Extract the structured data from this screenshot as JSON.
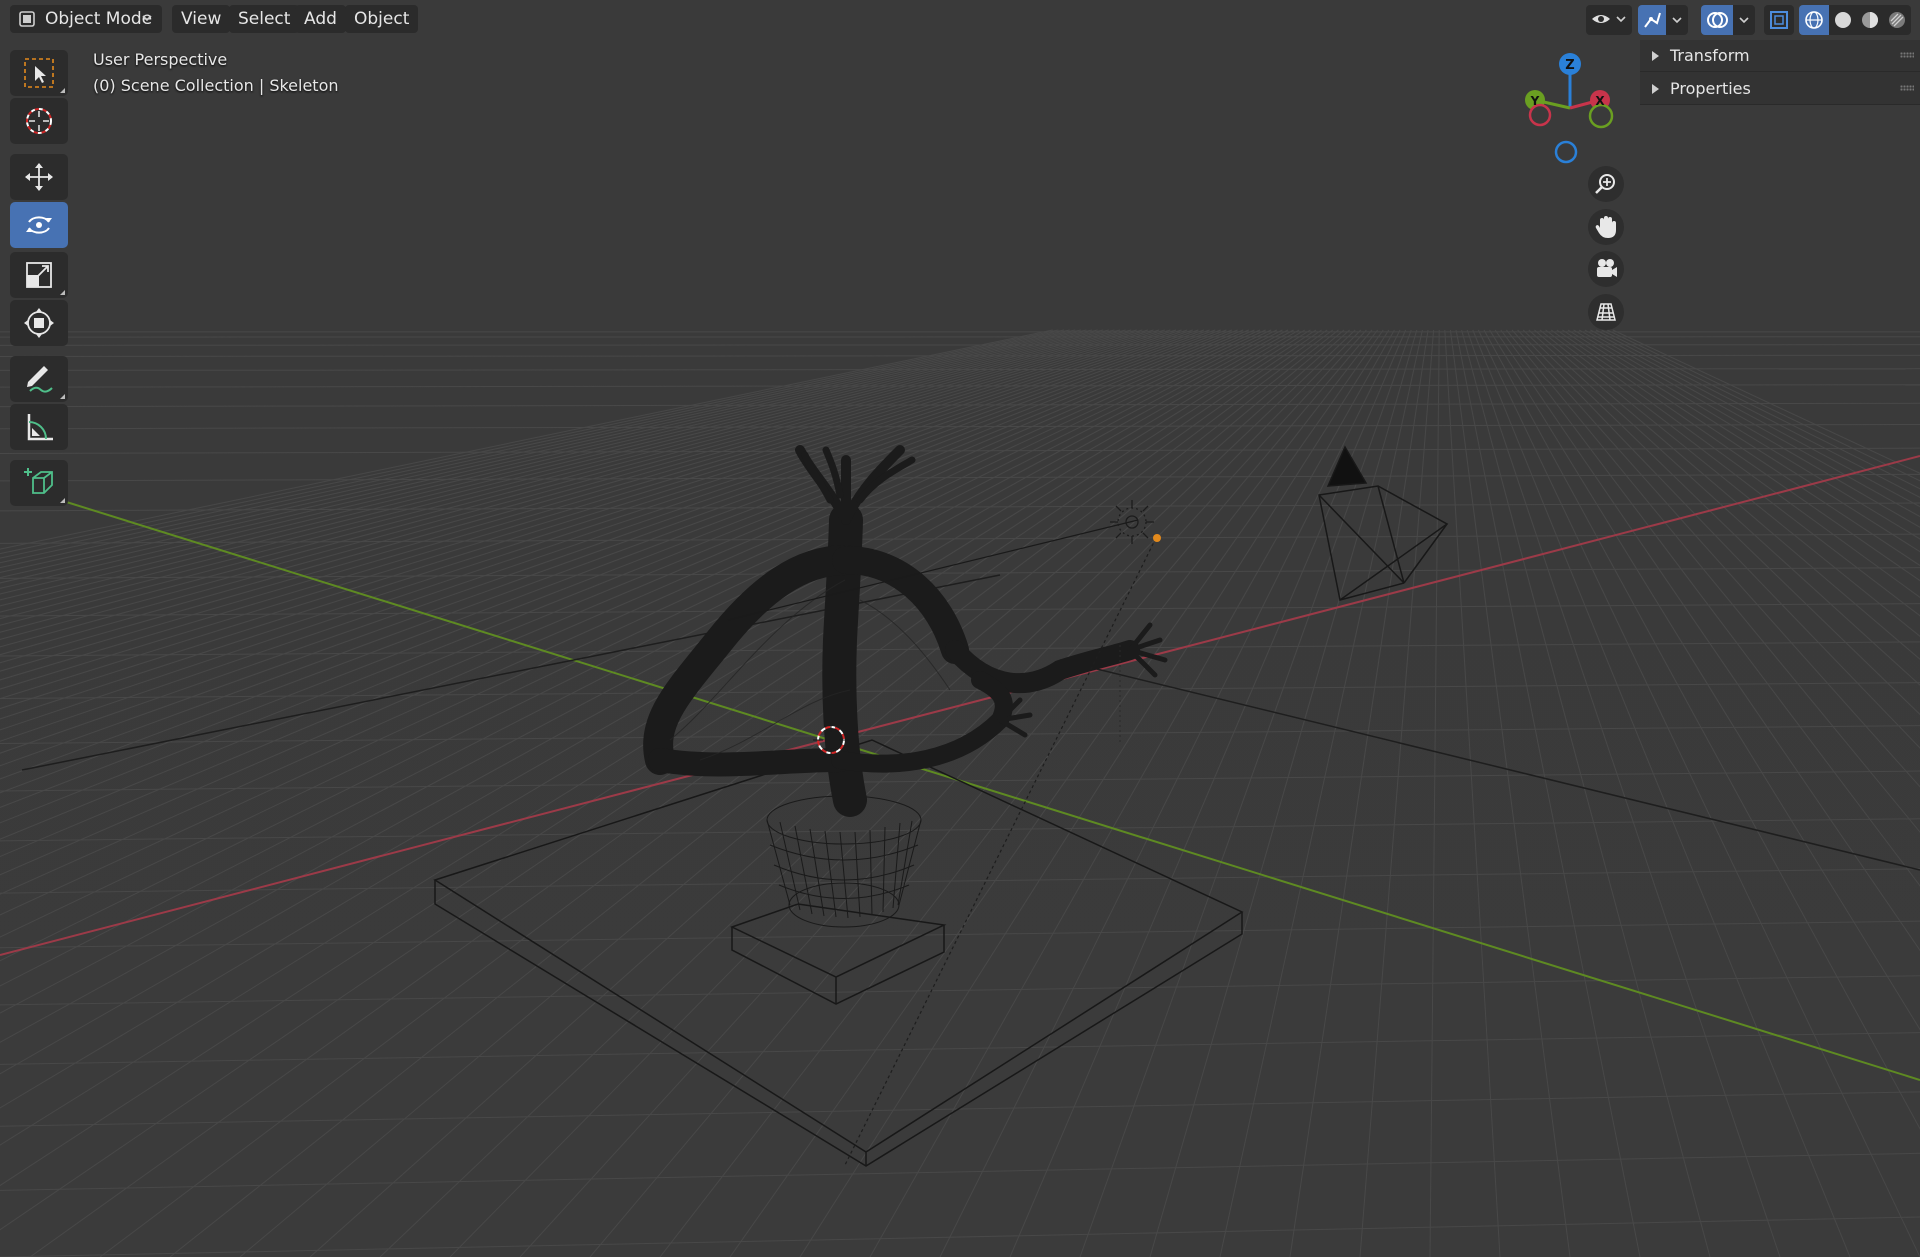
{
  "header": {
    "mode_label": "Object Mode",
    "menus": [
      "View",
      "Select",
      "Add",
      "Object"
    ],
    "right_icons": [
      "eye-visibility-icon",
      "gizmo-toggle-icon",
      "overlay-toggle-icon",
      "xray-toggle-icon",
      "wireframe-shading-icon",
      "solid-shading-icon",
      "material-shading-icon",
      "rendered-shading-icon"
    ]
  },
  "viewport": {
    "view_name": "User Perspective",
    "collection_info": "(0) Scene Collection | Skeleton",
    "axis_colors": {
      "x": "#c8344b",
      "y": "#6a9f21",
      "z": "#2a80d8"
    },
    "gizmo_labels": {
      "z": "Z",
      "y": "Y",
      "x": "X"
    }
  },
  "toolbar": {
    "tools": [
      "select-box-tool",
      "cursor-tool",
      "move-tool",
      "rotate-tool",
      "scale-tool",
      "transform-tool",
      "annotate-tool",
      "measure-tool",
      "add-cube-tool"
    ],
    "active_tool": "rotate-tool"
  },
  "navigation": [
    "zoom-icon",
    "pan-hand-icon",
    "camera-view-icon",
    "ortho-grid-icon"
  ],
  "sidebar": {
    "panels": [
      {
        "label": "Transform"
      },
      {
        "label": "Properties"
      }
    ]
  },
  "colors": {
    "accent": "#4772b3",
    "background": "#3a3a3a"
  }
}
